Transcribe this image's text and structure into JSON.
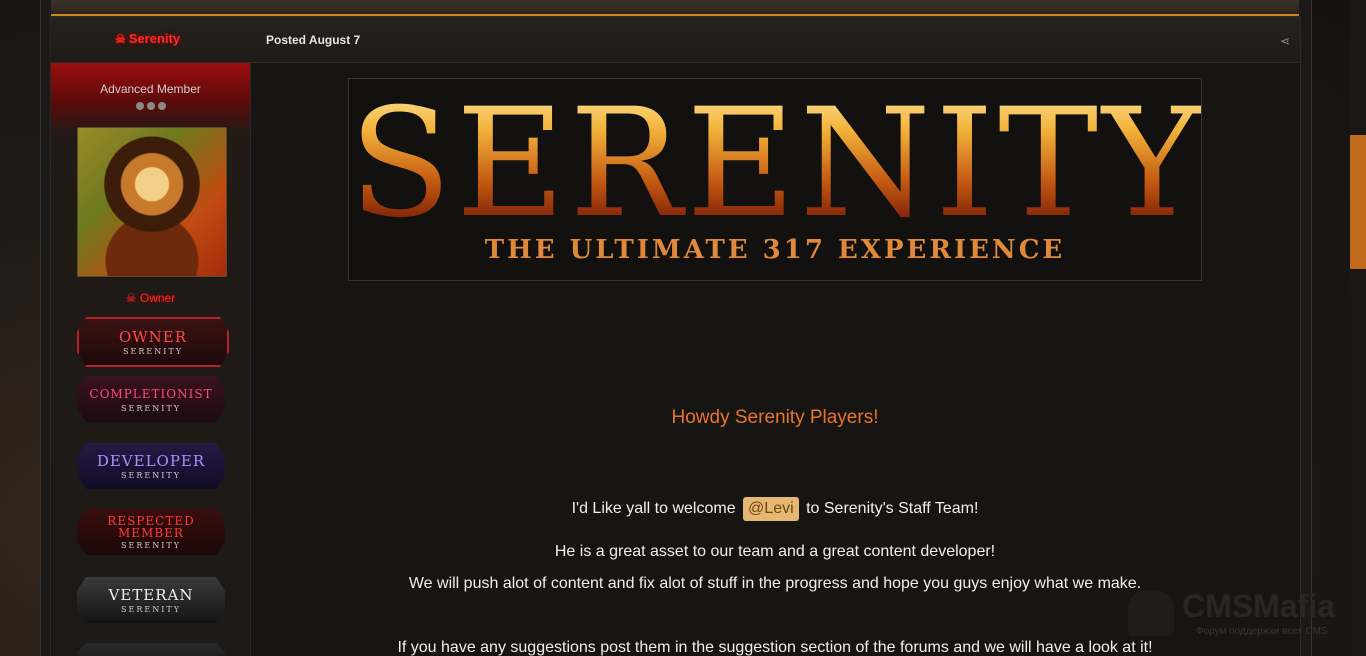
{
  "post": {
    "author": "Serenity",
    "posted": "Posted August 7"
  },
  "sidebar": {
    "member_title": "Advanced Member",
    "role": "Owner",
    "badges": [
      {
        "main": "OWNER",
        "sub": "SERENITY"
      },
      {
        "main": "COMPLETIONIST",
        "sub": "SERENITY"
      },
      {
        "main": "DEVELOPER",
        "sub": "SERENITY"
      },
      {
        "main": "RESPECTED MEMBER",
        "sub": "SERENITY"
      },
      {
        "main": "VETERAN",
        "sub": "SERENITY"
      }
    ]
  },
  "banner": {
    "title": "SERENITY",
    "subtitle": "THE ULTIMATE 317 EXPERIENCE"
  },
  "body": {
    "headline": "Howdy Serenity Players!",
    "welcome_pre": "I'd Like yall to welcome",
    "mention": "@Levi",
    "welcome_post": "to Serenity's Staff Team!",
    "line2": "He is a great asset to our team and a great content developer!",
    "line3": "We will push alot of content and fix alot of stuff in the progress and hope you guys enjoy what we make.",
    "line4": "If you have any suggestions post them in the suggestion section of the forums and we will have a look at it!"
  },
  "watermark": {
    "brand": "CMSMafia",
    "tagline": "Форум поддержки всех CMS"
  },
  "icons": {
    "author": "skull-icon",
    "share": "share-icon"
  },
  "colors": {
    "accent": "#c8871c",
    "author": "#ff2a2a",
    "headline": "#e7742a",
    "mention_bg": "#e6b772"
  }
}
